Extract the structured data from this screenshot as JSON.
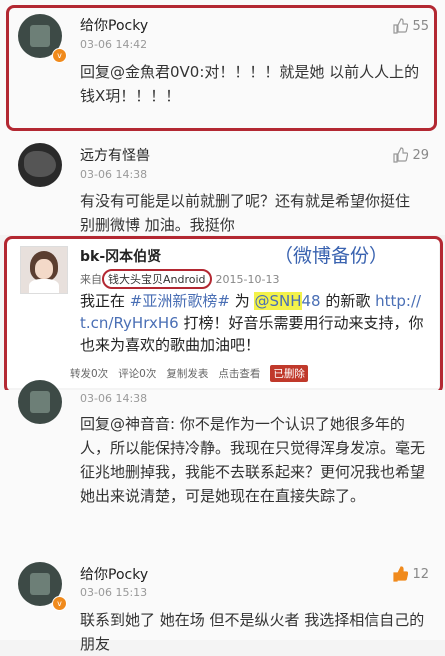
{
  "comments": [
    {
      "name": "给你Pocky",
      "time": "03-06 14:42",
      "likes": "55",
      "text": "回复@金魚君0V0:对！！！！就是她 以前人人上的钱X玥！！！！"
    },
    {
      "name": "远方有怪兽",
      "time": "03-06 14:38",
      "likes": "29",
      "text": "有没有可能是以前就删了呢？还有就是希望你挺住 别删微博 加油。我挺你"
    },
    {
      "time": "03-06 14:38",
      "text": "回复@神音音: 你不是作为一个认识了她很多年的人，所以能保持冷静。我现在只觉得浑身发凉。毫无征兆地删掉我，我能不去联系起来？更何况我也希望她出来说清楚，可是她现在在直接失踪了。"
    },
    {
      "name": "给你Pocky",
      "time": "03-06 15:13",
      "likes": "12",
      "text": "联系到她了 她在场 但不是纵火者 我选择相信自己的朋友"
    }
  ],
  "repost": {
    "name": "bk-冈本伯贤",
    "annotation": "（微博备份）",
    "source_prefix": "来自",
    "source_app": "钱大头宝贝Android",
    "date": "2015-10-13",
    "text_1": "我正在 ",
    "hashtag": "#亚洲新歌榜#",
    "text_2": " 为 ",
    "mention": "@SNH",
    "mention_2": "48",
    "text_3": " 的新歌 ",
    "link": "http://t.cn/RyHrxH6",
    "text_4": " 打榜！好音乐需要用行动来支持，你也来为喜欢的歌曲加油吧！",
    "repost_count": "转发0次",
    "comment_count": "评论0次",
    "copy_label": "复制发表",
    "view_label": "点击查看",
    "deleted_label": "已删除"
  },
  "colors": {
    "highlight_box": "#b32832",
    "link": "#4a6fb5",
    "badge": "#f08a1c"
  }
}
